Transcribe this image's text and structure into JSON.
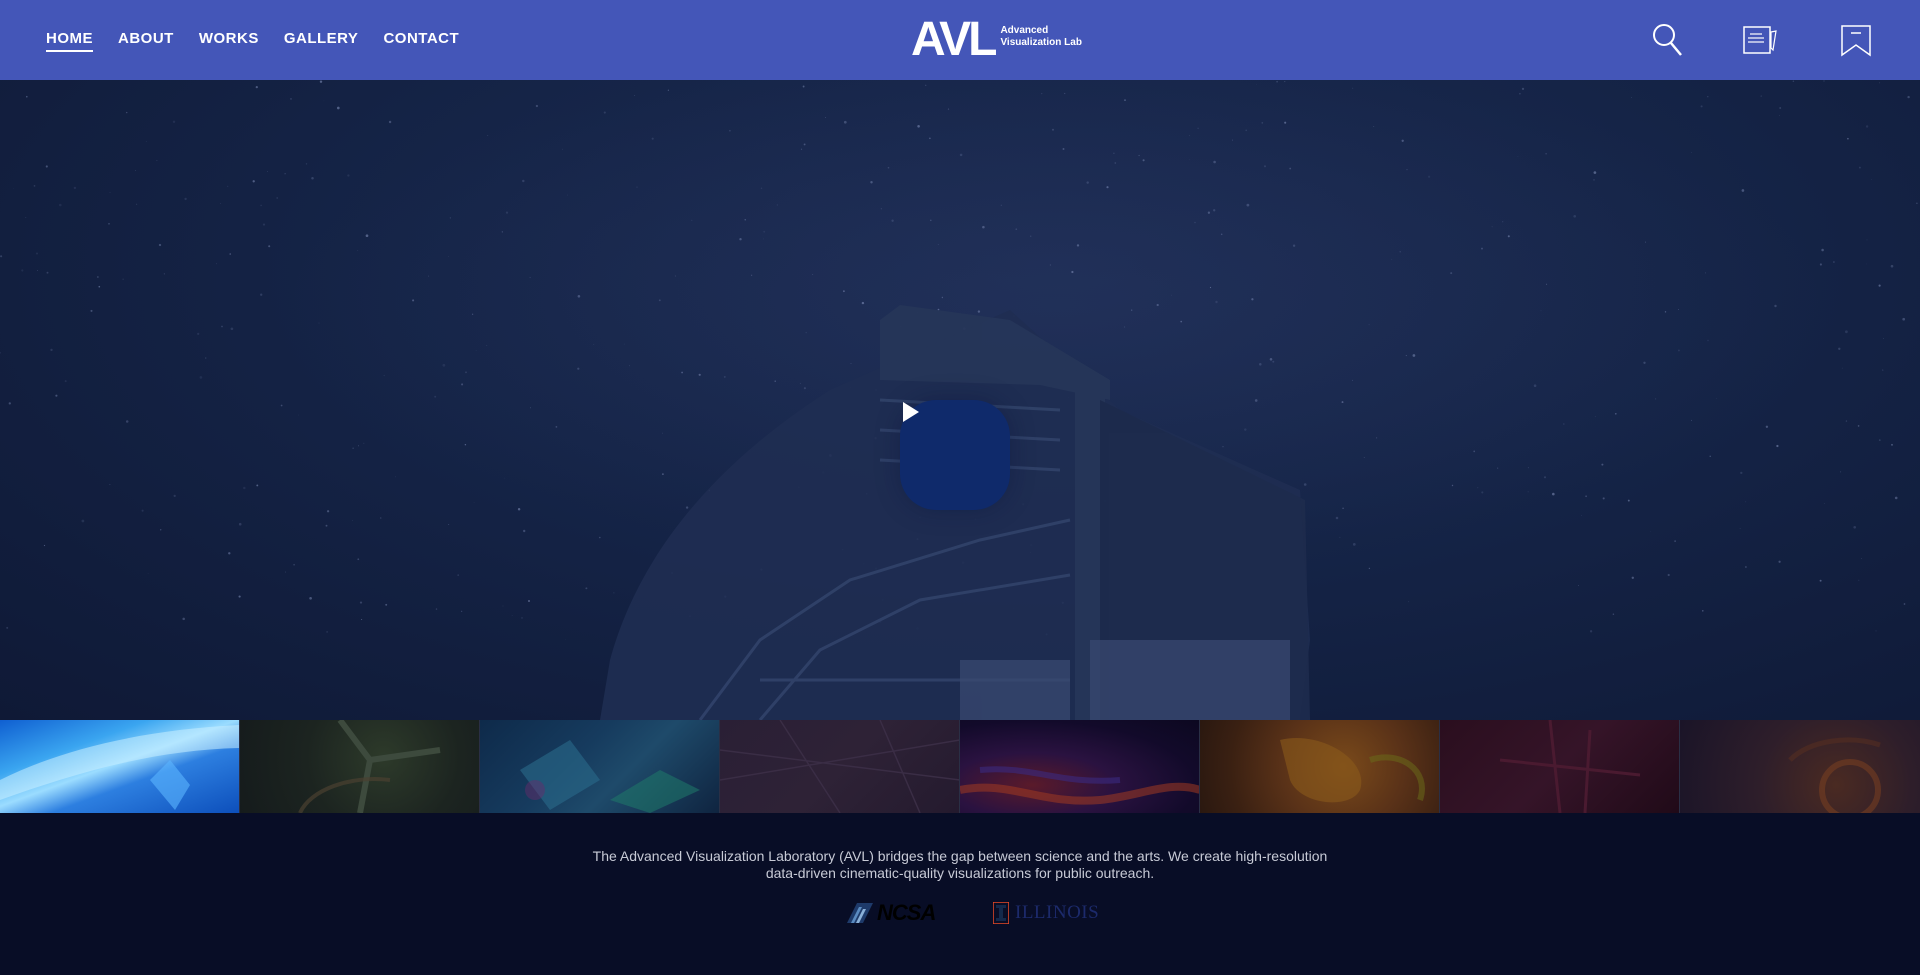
{
  "nav": {
    "items": [
      {
        "label": "HOME",
        "active": true
      },
      {
        "label": "ABOUT"
      },
      {
        "label": "WORKS"
      },
      {
        "label": "GALLERY"
      },
      {
        "label": "CONTACT"
      }
    ]
  },
  "logo": {
    "mark": "AVL",
    "line1": "Advanced",
    "line2": "Visualization Lab"
  },
  "header_icons": [
    "search-icon",
    "notes-icon",
    "bookmark-icon"
  ],
  "hero": {
    "play_icon": "play-icon"
  },
  "thumbnails": 8,
  "footer": {
    "line1": "The Advanced Visualization Laboratory (AVL) bridges the gap between science and the arts. We create high-resolution",
    "line2": "data-driven cinematic-quality visualizations for public outreach.",
    "ncsa_label": "NCSA",
    "illinois_label": "ILLINOIS"
  },
  "colors": {
    "header": "#4456b8",
    "hero": "#152447",
    "play_button": "#0f2a6b",
    "footer": "#080d26"
  }
}
